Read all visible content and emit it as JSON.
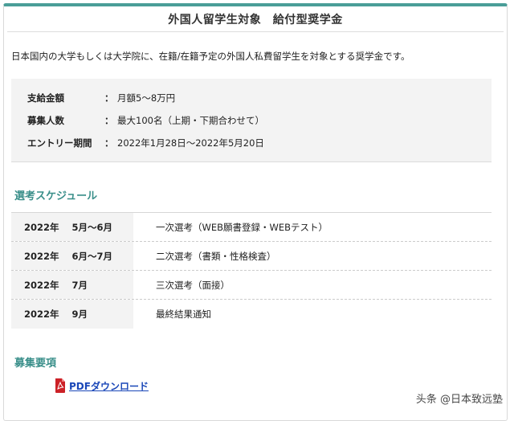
{
  "header": {
    "title": "外国人留学生対象　給付型奨学金"
  },
  "intro": {
    "text": "日本国内の大学もしくは大学院に、在籍/在籍予定の外国人私費留学生を対象とする奨学金です。"
  },
  "info": {
    "colon": "：",
    "rows": [
      {
        "label": "支給金額",
        "value": "月額5〜8万円"
      },
      {
        "label": "募集人数",
        "value": "最大100名（上期・下期合わせて）"
      },
      {
        "label": "エントリー期間",
        "value": "2022年1月28日〜2022年5月20日"
      }
    ]
  },
  "schedule": {
    "title": "選考スケジュール",
    "rows": [
      {
        "year": "2022年",
        "month": "5月〜6月",
        "desc": "一次選考（WEB願書登録・WEBテスト）"
      },
      {
        "year": "2022年",
        "month": "6月〜7月",
        "desc": "二次選考（書類・性格検査）"
      },
      {
        "year": "2022年",
        "month": "7月",
        "desc": "三次選考（面接）"
      },
      {
        "year": "2022年",
        "month": "9月",
        "desc": "最終結果通知"
      }
    ]
  },
  "recruitment": {
    "title": "募集要項",
    "pdf_link": "PDFダウンロード"
  },
  "watermark": {
    "text": "头条 @日本致远塾"
  },
  "colors": {
    "accent": "#4a9e98",
    "section_title": "#3a8f8a",
    "link": "#1a47b8",
    "pdf_icon": "#cc2127"
  }
}
